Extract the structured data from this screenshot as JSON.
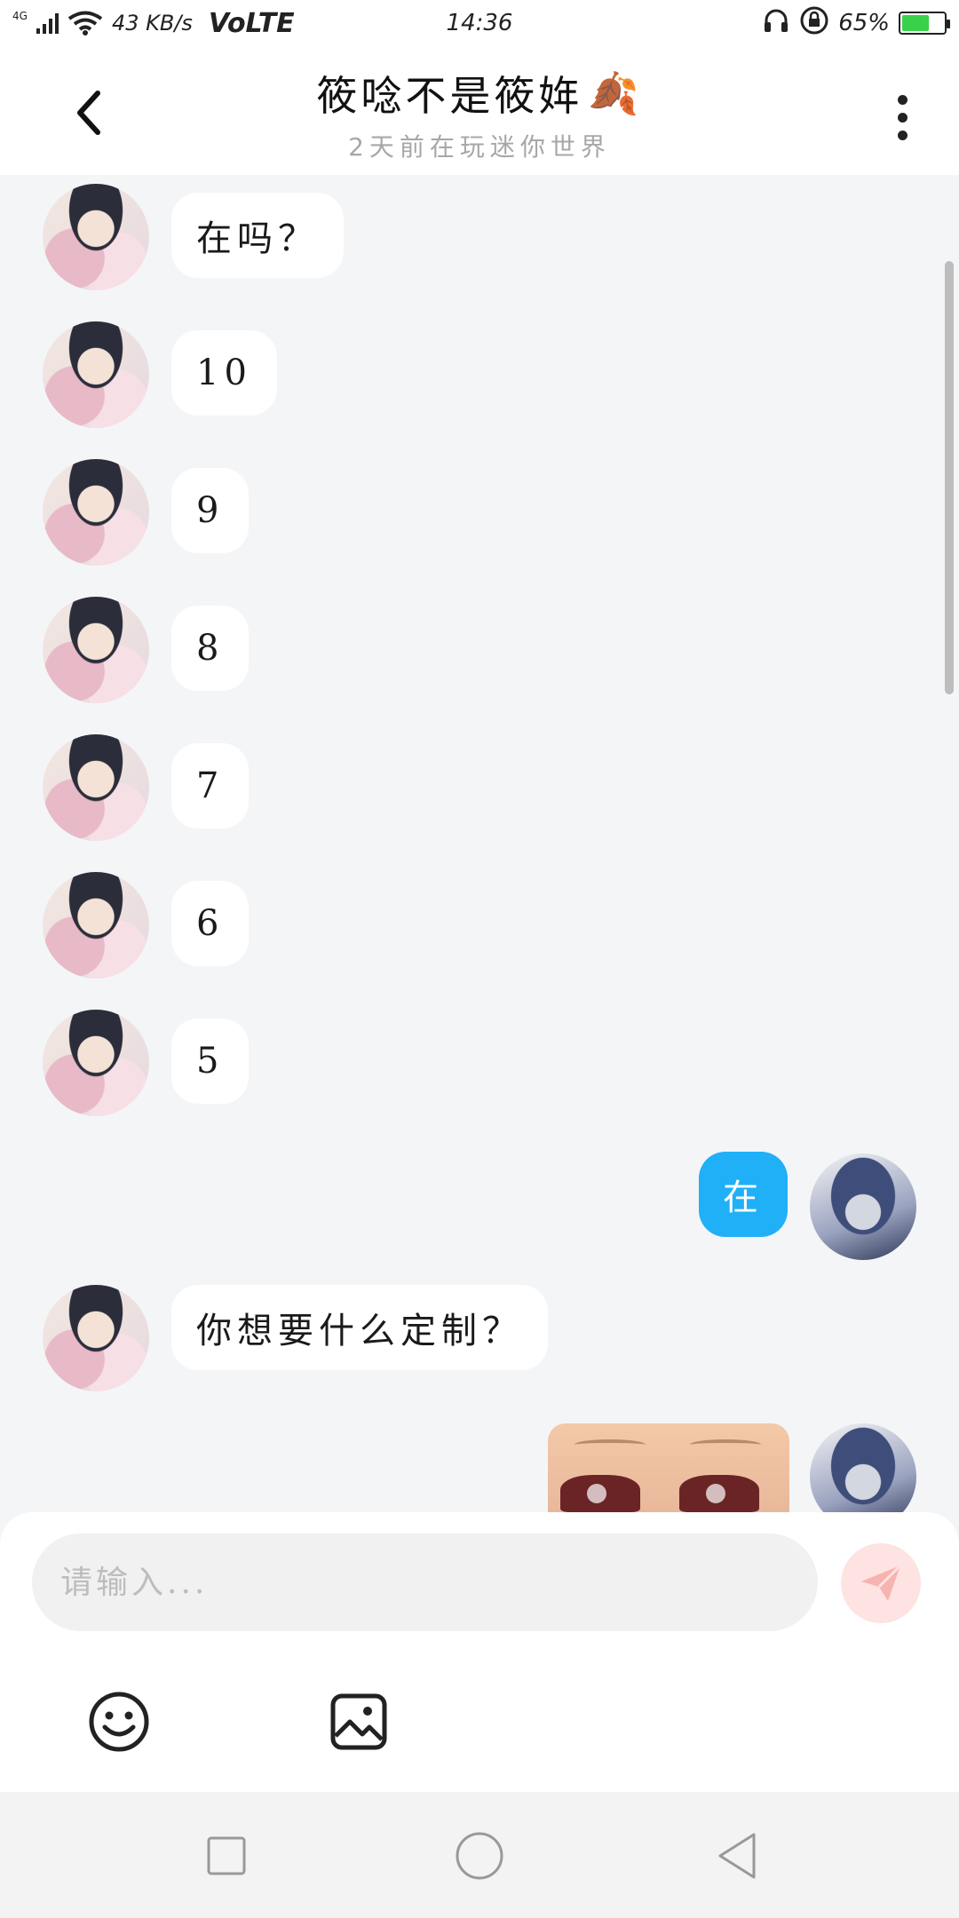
{
  "status_bar": {
    "network": "4G",
    "speed": "43 KB/s",
    "volte": "VoLTE",
    "time": "14:36",
    "battery": "65%",
    "battery_level": 0.65,
    "battery_color": "#3ad14a"
  },
  "header": {
    "title": "筱唸不是筱姩",
    "title_emoji": "🍂",
    "subtitle": "2天前在玩迷你世界"
  },
  "messages": [
    {
      "from": "other",
      "text": "在吗？"
    },
    {
      "from": "other",
      "text": "10"
    },
    {
      "from": "other",
      "text": "9"
    },
    {
      "from": "other",
      "text": "8"
    },
    {
      "from": "other",
      "text": "7"
    },
    {
      "from": "other",
      "text": "6"
    },
    {
      "from": "other",
      "text": "5"
    },
    {
      "from": "me",
      "text": "在"
    },
    {
      "from": "other",
      "text": "你想要什么定制？"
    },
    {
      "from": "me",
      "type": "image"
    }
  ],
  "input": {
    "placeholder": "请输入..."
  },
  "colors": {
    "accent": "#1fb0f8",
    "send_button": "#fde3e2",
    "background": "#f4f5f7"
  },
  "icons": {
    "back": "chevron-left-icon",
    "more": "more-vertical-icon",
    "send": "paper-plane-icon",
    "emoji": "smiley-icon",
    "image": "image-icon"
  }
}
